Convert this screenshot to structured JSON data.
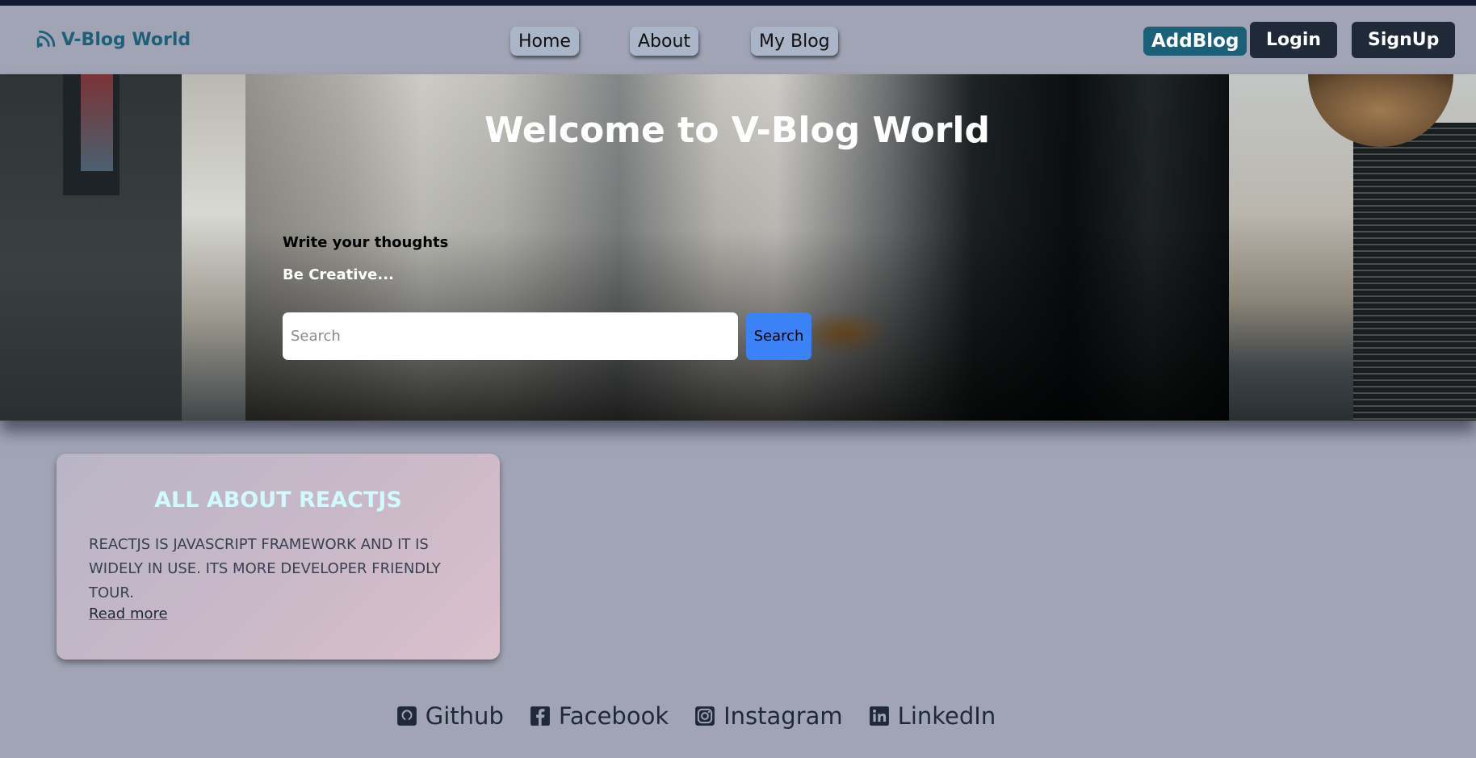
{
  "header": {
    "brand": "V-Blog World",
    "nav": {
      "home": "Home",
      "about": "About",
      "my_blog": "My Blog"
    },
    "add_blog": "AddBlog",
    "login": "Login",
    "signup": "SignUp"
  },
  "hero": {
    "title": "Welcome to V-Blog World",
    "subtitle1": "Write your thoughts",
    "subtitle2": "Be Creative...",
    "search": {
      "placeholder": "Search",
      "button": "Search"
    }
  },
  "posts": [
    {
      "title": "ALL ABOUT REACTJS",
      "body": "REACTJS IS JAVASCRIPT FRAMEWORK AND IT IS WIDELY IN USE. ITS MORE DEVELOPER FRIENDLY TOUR.",
      "link": "Read more"
    }
  ],
  "footer": {
    "links": [
      {
        "label": "Github",
        "icon": "github-icon"
      },
      {
        "label": "Facebook",
        "icon": "facebook-icon"
      },
      {
        "label": "Instagram",
        "icon": "instagram-icon"
      },
      {
        "label": "LinkedIn",
        "icon": "linkedin-icon"
      }
    ]
  },
  "colors": {
    "background": "#a0a4b5",
    "brand": "#1f5f78",
    "add_blog": "#1c6078",
    "dark_button": "#1f2937",
    "search_button": "#3b82f6",
    "card_title": "#cffafe"
  }
}
